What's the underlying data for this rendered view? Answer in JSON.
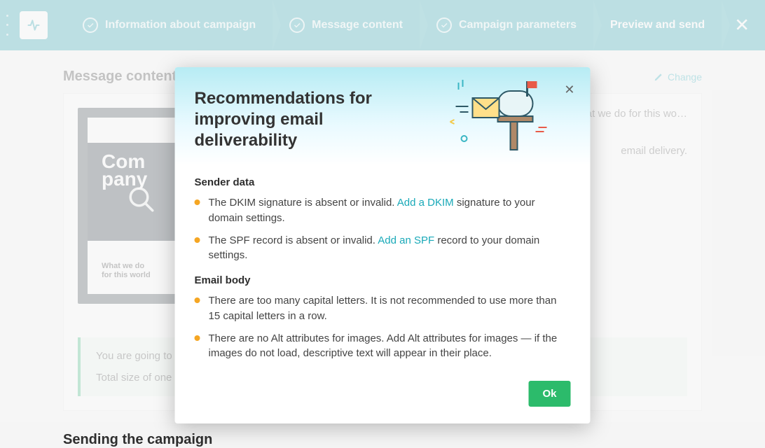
{
  "topbar": {
    "steps": [
      {
        "label": "Information about campaign",
        "done": true
      },
      {
        "label": "Message content",
        "done": true
      },
      {
        "label": "Campaign parameters",
        "done": true
      },
      {
        "label": "Preview and send",
        "done": false,
        "active": true
      }
    ]
  },
  "section_message": {
    "title": "Message content",
    "change_label": "Change",
    "preview_brand_line1": "Com",
    "preview_brand_line2": "pany",
    "preview_caption": "What we do for this world",
    "sub_truncated": "at we do for this wo…",
    "sub_delivery": "email delivery."
  },
  "alert": {
    "line1": "You are going to send",
    "line2": "Total size of one em"
  },
  "section_sending": {
    "title": "Sending the campaign"
  },
  "modal": {
    "title_line1": "Recommendations for",
    "title_line2": "improving email deliverability",
    "groups": [
      {
        "heading": "Sender data",
        "items": [
          {
            "before": "The DKIM signature is absent or invalid. ",
            "link": "Add a DKIM",
            "after": " signature to your domain settings."
          },
          {
            "before": "The SPF record is absent or invalid. ",
            "link": "Add an SPF",
            "after": " record to your domain settings."
          }
        ]
      },
      {
        "heading": "Email body",
        "items": [
          {
            "before": "There are too many capital letters. It is not recommended to use more than 15 capital letters in a row.",
            "link": "",
            "after": ""
          },
          {
            "before": "There are no Alt attributes for images. Add Alt attributes for images — if the images do not load, descriptive text will appear in their place.",
            "link": "",
            "after": ""
          }
        ]
      }
    ],
    "ok_label": "Ok"
  }
}
